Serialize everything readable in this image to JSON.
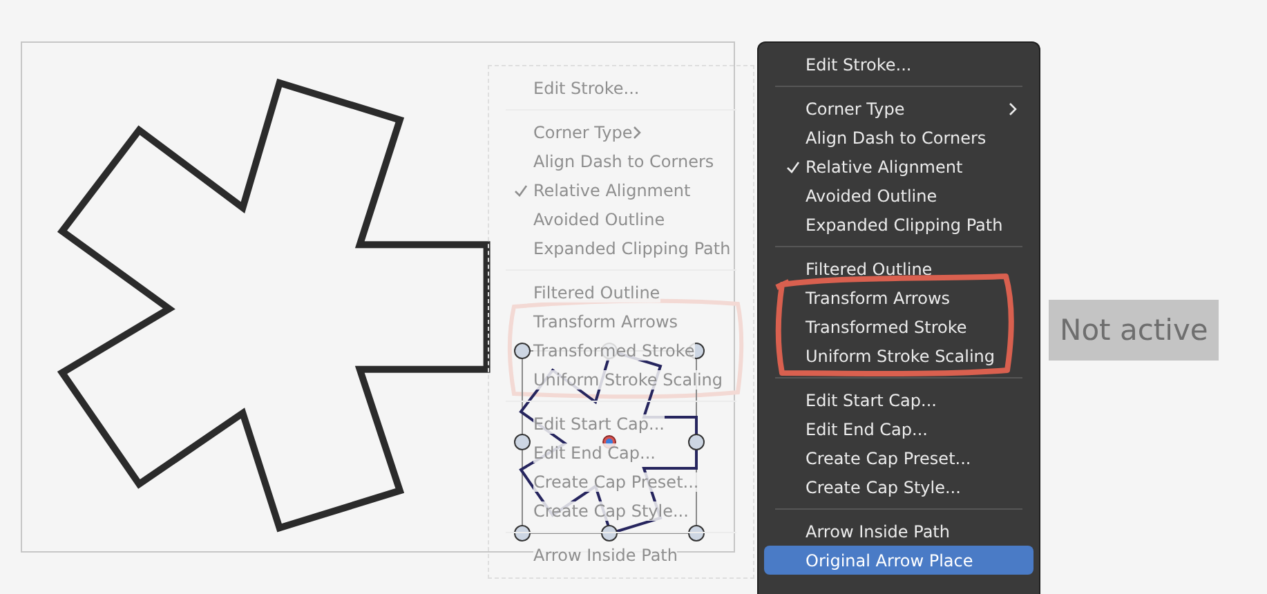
{
  "canvas": {
    "ghost_menu": {
      "items": [
        {
          "kind": "item",
          "label": "Edit Stroke...",
          "checked": false
        },
        {
          "kind": "separator"
        },
        {
          "kind": "submenu",
          "label": "Corner Type",
          "checked": false
        },
        {
          "kind": "item",
          "label": "Align Dash to Corners",
          "checked": false
        },
        {
          "kind": "item",
          "label": "Relative Alignment",
          "checked": true
        },
        {
          "kind": "item",
          "label": "Avoided Outline",
          "checked": false
        },
        {
          "kind": "item",
          "label": "Expanded Clipping Path",
          "checked": false
        },
        {
          "kind": "separator"
        },
        {
          "kind": "item",
          "label": "Filtered Outline",
          "checked": false
        },
        {
          "kind": "item",
          "label": "Transform Arrows",
          "checked": false
        },
        {
          "kind": "item",
          "label": "Transformed Stroke",
          "checked": false
        },
        {
          "kind": "item",
          "label": "Uniform Stroke Scaling",
          "checked": false
        },
        {
          "kind": "separator"
        },
        {
          "kind": "item",
          "label": "Edit Start Cap...",
          "checked": false
        },
        {
          "kind": "item",
          "label": "Edit End Cap...",
          "checked": false
        },
        {
          "kind": "item",
          "label": "Create Cap Preset...",
          "checked": false
        },
        {
          "kind": "item",
          "label": "Create Cap Style...",
          "checked": false
        },
        {
          "kind": "separator"
        },
        {
          "kind": "item",
          "label": "Arrow Inside Path",
          "checked": false
        }
      ]
    }
  },
  "menu": {
    "items": [
      {
        "kind": "item",
        "label": "Edit Stroke...",
        "checked": false,
        "selected": false
      },
      {
        "kind": "separator"
      },
      {
        "kind": "submenu",
        "label": "Corner Type",
        "checked": false,
        "selected": false
      },
      {
        "kind": "item",
        "label": "Align Dash to Corners",
        "checked": false,
        "selected": false
      },
      {
        "kind": "item",
        "label": "Relative Alignment",
        "checked": true,
        "selected": false
      },
      {
        "kind": "item",
        "label": "Avoided Outline",
        "checked": false,
        "selected": false
      },
      {
        "kind": "item",
        "label": "Expanded Clipping Path",
        "checked": false,
        "selected": false
      },
      {
        "kind": "separator"
      },
      {
        "kind": "item",
        "label": "Filtered Outline",
        "checked": false,
        "selected": false
      },
      {
        "kind": "item",
        "label": "Transform Arrows",
        "checked": false,
        "selected": false
      },
      {
        "kind": "item",
        "label": "Transformed Stroke",
        "checked": false,
        "selected": false
      },
      {
        "kind": "item",
        "label": "Uniform Stroke Scaling",
        "checked": false,
        "selected": false
      },
      {
        "kind": "separator"
      },
      {
        "kind": "item",
        "label": "Edit Start Cap...",
        "checked": false,
        "selected": false
      },
      {
        "kind": "item",
        "label": "Edit End Cap...",
        "checked": false,
        "selected": false
      },
      {
        "kind": "item",
        "label": "Create Cap Preset...",
        "checked": false,
        "selected": false
      },
      {
        "kind": "item",
        "label": "Create Cap Style...",
        "checked": false,
        "selected": false
      },
      {
        "kind": "separator"
      },
      {
        "kind": "item",
        "label": "Arrow Inside Path",
        "checked": false,
        "selected": false
      },
      {
        "kind": "item",
        "label": "Original Arrow Place",
        "checked": false,
        "selected": true
      }
    ]
  },
  "status_label": {
    "label": "Not active"
  }
}
